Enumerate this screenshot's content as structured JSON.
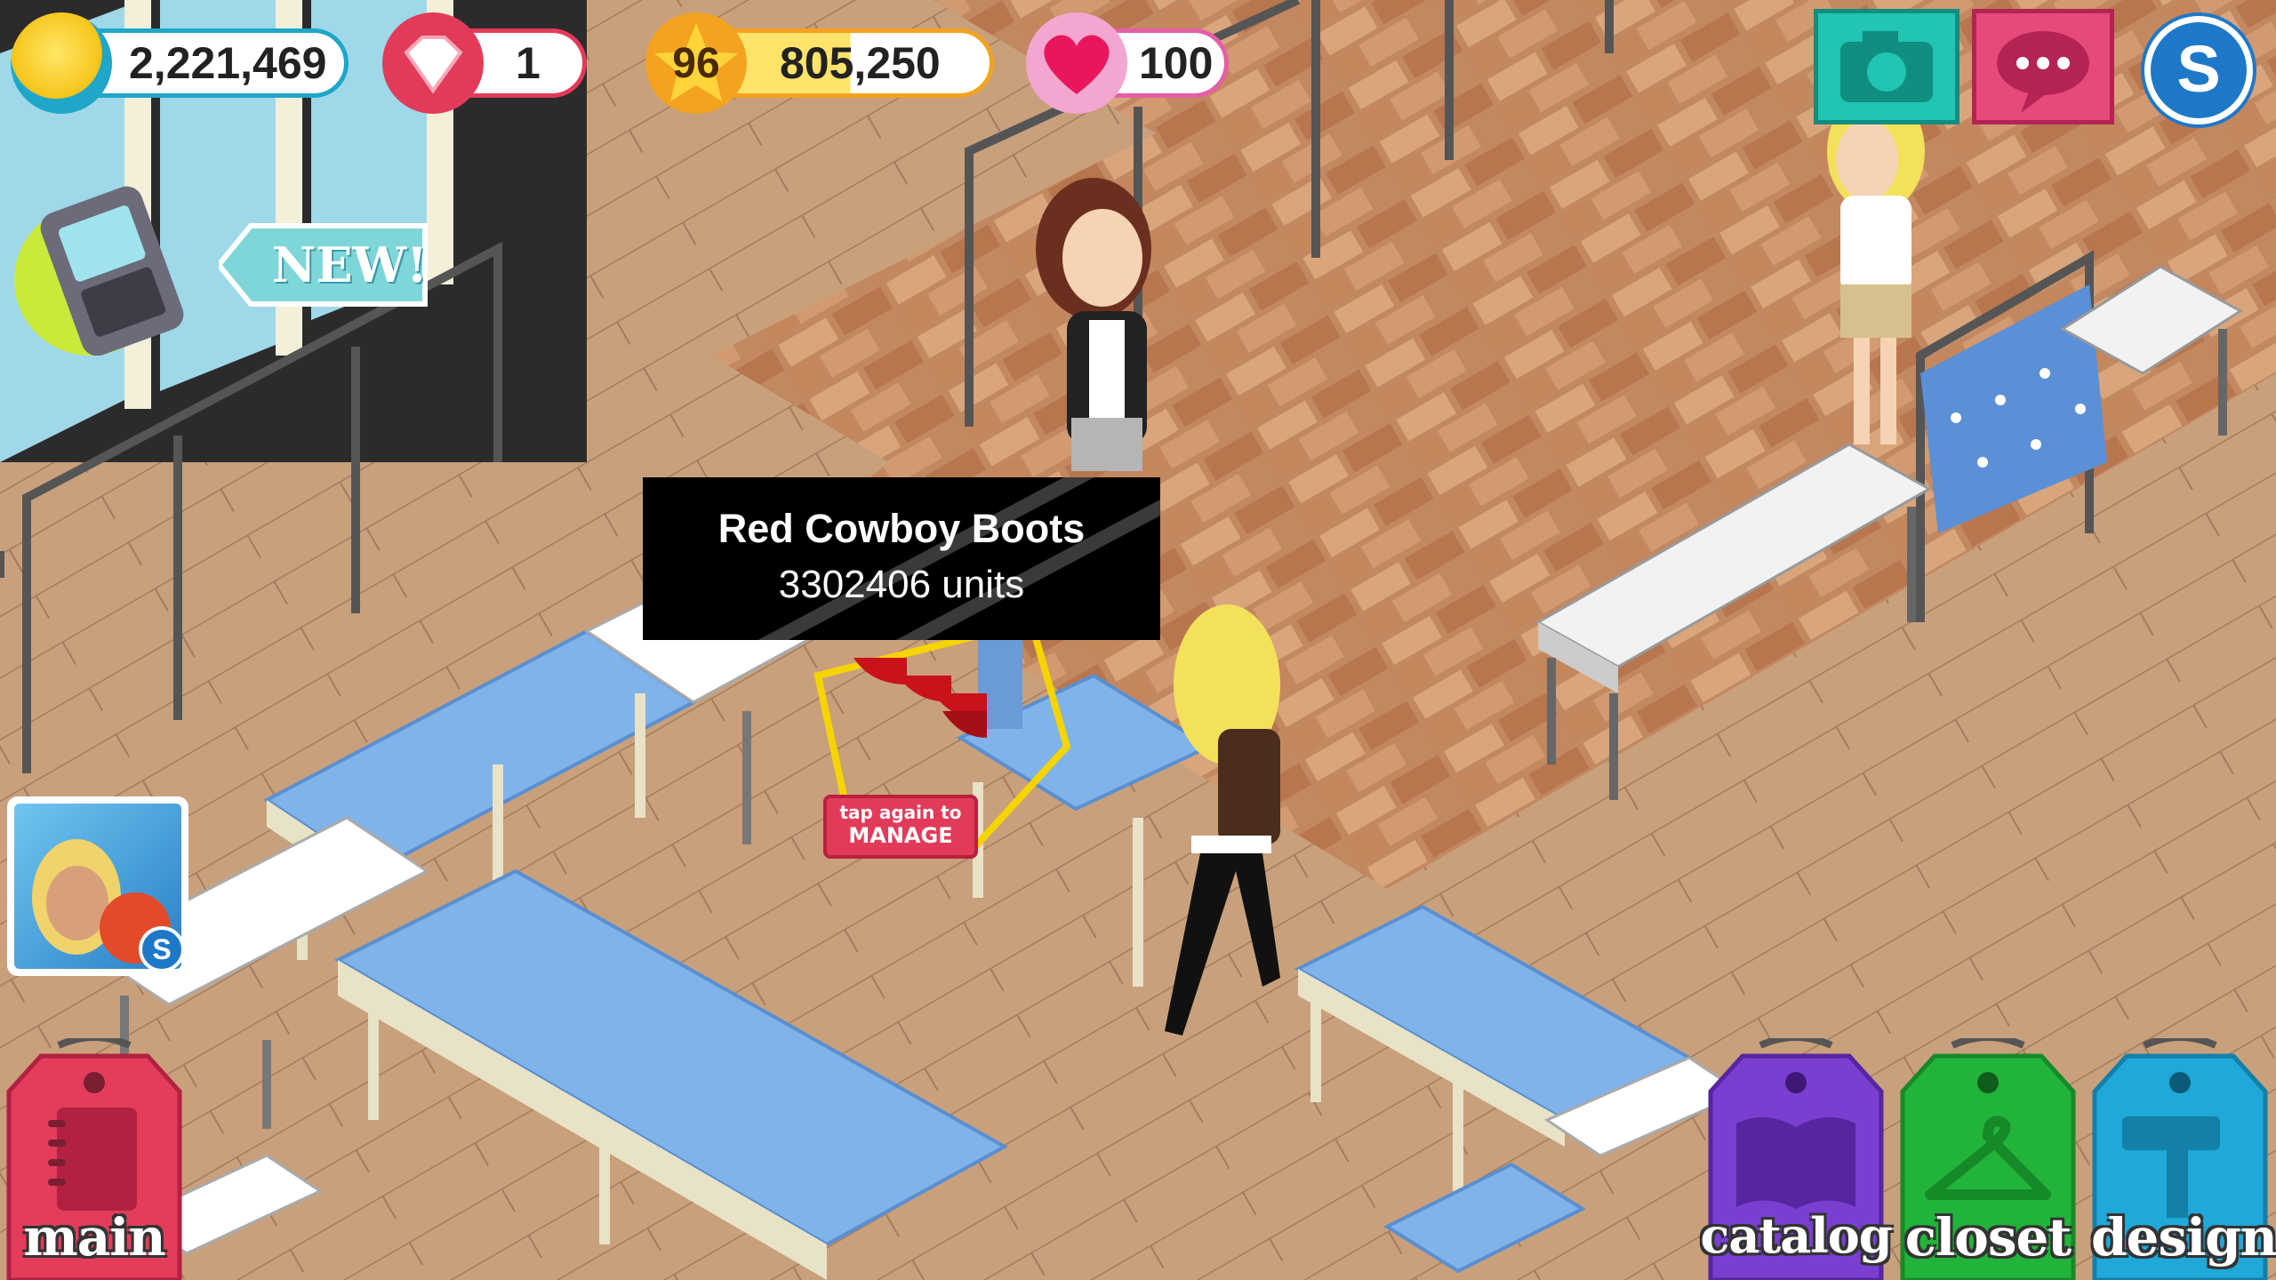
{
  "hud": {
    "coins": "2,221,469",
    "gems": "1",
    "level": "96",
    "xp": "805,250",
    "hearts": "100"
  },
  "badges": {
    "new": "NEW!"
  },
  "tooltip": {
    "item_name": "Red Cowboy Boots",
    "quantity": "3302406 units"
  },
  "manage_prompt": {
    "line1": "tap again to",
    "line2": "MANAGE"
  },
  "nav": {
    "main": "main",
    "catalog": "catalog",
    "closet": "closet",
    "design": "design"
  },
  "icons": {
    "coin": "coin-icon",
    "gem": "gem-icon",
    "level": "star-icon",
    "heart": "heart-icon",
    "camera": "camera-icon",
    "chat": "chat-icon",
    "account": "account-s-icon",
    "phone": "phone-icon"
  },
  "colors": {
    "hud_coin": "#1fa6c9",
    "hud_gem": "#e23b5a",
    "hud_level": "#f3a31f",
    "hud_heart": "#e55fa6",
    "camera": "#22c4b3",
    "chat": "#e64a7a",
    "account": "#1e78c8",
    "main": "#e33d5b",
    "catalog": "#7a3fd0",
    "closet": "#22b43a",
    "design": "#1fa8d8",
    "floor_wood": "#c9a07c",
    "floor_brick": "#b97a52"
  }
}
